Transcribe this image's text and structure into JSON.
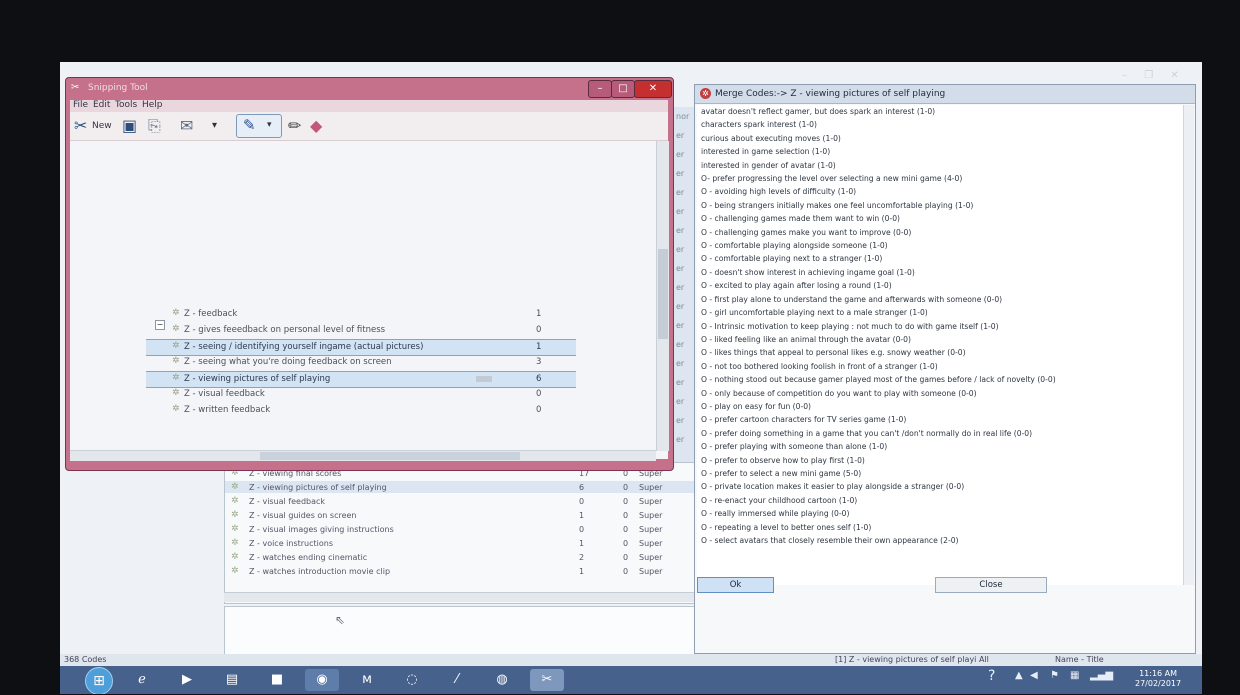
{
  "background_app": {
    "rows": [
      {
        "name": "Z - viewing final scores",
        "c1": "17",
        "c2": "0",
        "c3": "Super"
      },
      {
        "name": "Z - viewing pictures of self playing",
        "c1": "6",
        "c2": "0",
        "c3": "Super"
      },
      {
        "name": "Z - visual feedback",
        "c1": "0",
        "c2": "0",
        "c3": "Super"
      },
      {
        "name": "Z - visual guides on screen",
        "c1": "1",
        "c2": "0",
        "c3": "Super"
      },
      {
        "name": "Z - visual images giving instructions",
        "c1": "0",
        "c2": "0",
        "c3": "Super"
      },
      {
        "name": "Z - voice instructions",
        "c1": "1",
        "c2": "0",
        "c3": "Super"
      },
      {
        "name": "Z - watches ending cinematic",
        "c1": "2",
        "c2": "0",
        "c3": "Super"
      },
      {
        "name": "Z - watches introduction movie clip",
        "c1": "1",
        "c2": "0",
        "c3": "Super"
      }
    ],
    "side_column": [
      "nor",
      "er",
      "er",
      "er",
      "er",
      "er",
      "er",
      "er",
      "er",
      "er",
      "er",
      "er",
      "er",
      "er",
      "er",
      "er",
      "er",
      "er"
    ],
    "status": {
      "codes_count": "368 Codes",
      "selection": "[1] Z - viewing pictures of self playi All",
      "sort": "Name - Title"
    }
  },
  "snipping_tool": {
    "title": "Snipping Tool",
    "menu": [
      "File",
      "Edit",
      "Tools",
      "Help"
    ],
    "new_label": "New",
    "rows": [
      {
        "name": "Z - feedback",
        "count": "1",
        "selected": false
      },
      {
        "name": "Z - gives feeedback on personal level of fitness",
        "count": "0",
        "selected": false
      },
      {
        "name": "Z - seeing / identifying yourself ingame (actual pictures)",
        "count": "1",
        "selected": true
      },
      {
        "name": "Z - seeing what you're doing feedback on screen",
        "count": "3",
        "selected": false
      },
      {
        "name": "Z - viewing pictures of self playing",
        "count": "6",
        "selected": true
      },
      {
        "name": "Z - visual feedback",
        "count": "0",
        "selected": false
      },
      {
        "name": "Z - written feedback",
        "count": "0",
        "selected": false
      }
    ]
  },
  "merge_dialog": {
    "title": "Merge Codes:-> Z - viewing pictures of self playing",
    "items": [
      "avatar doesn't reflect gamer, but does spark an interest (1-0)",
      "characters spark interest (1-0)",
      "curious about executing moves (1-0)",
      "interested in game selection (1-0)",
      "interested in gender of avatar (1-0)",
      "O- prefer progressing the level over selecting a new mini game (4-0)",
      "O - avoiding high levels of difficulty (1-0)",
      "O - being strangers initially makes one feel uncomfortable playing (1-0)",
      "O - challenging games made them want to win (0-0)",
      "O - challenging games make you want to improve (0-0)",
      "O - comfortable playing alongside someone (1-0)",
      "O - comfortable playing next to a stranger (1-0)",
      "O - doesn't show interest in achieving ingame goal (1-0)",
      "O - excited to play again after losing a round (1-0)",
      "O - first play alone to understand the game and afterwards with someone (0-0)",
      "O - girl uncomfortable playing next to a male stranger (1-0)",
      "O - Intrinsic motivation to keep playing : not much to do with game itself (1-0)",
      "O - liked feeling like an animal through the avatar (0-0)",
      "O - likes things that appeal to personal likes e.g. snowy weather (0-0)",
      "O - not too bothered looking foolish in front of a stranger (1-0)",
      "O - nothing stood out because gamer played most of the games before / lack of novelty (0-0)",
      "O - only because of competition do you want to play with someone (0-0)",
      "O - play on easy for fun (0-0)",
      "O - prefer cartoon characters for TV series game (1-0)",
      "O - prefer doing something in a game that you can't /don't normally do in real life (0-0)",
      "O - prefer playing with someone than alone (1-0)",
      "O - prefer to observe how to play first (1-0)",
      "O - prefer to select a new mini game (5-0)",
      "O - private location makes it easier to play alongside a stranger (0-0)",
      "O - re-enact your childhood cartoon (1-0)",
      "O - really immersed while playing (0-0)",
      "O - repeating a level to better ones self (1-0)",
      "O - select avatars that closely resemble their own appearance (2-0)"
    ],
    "ok_label": "Ok",
    "close_label": "Close"
  },
  "taskbar": {
    "clock_time": "11:16 AM",
    "clock_date": "27/02/2017"
  }
}
